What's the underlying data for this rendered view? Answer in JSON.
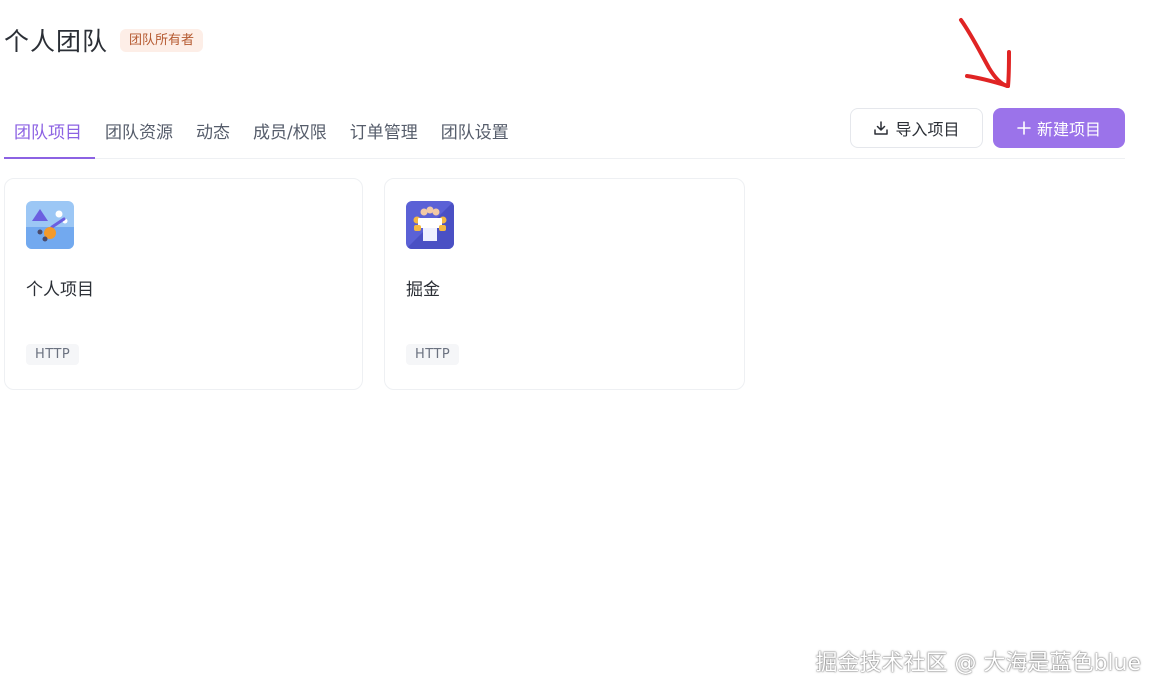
{
  "header": {
    "title": "个人团队",
    "role_badge": "团队所有者"
  },
  "tabs": [
    {
      "label": "团队项目",
      "active": true
    },
    {
      "label": "团队资源",
      "active": false
    },
    {
      "label": "动态",
      "active": false
    },
    {
      "label": "成员/权限",
      "active": false
    },
    {
      "label": "订单管理",
      "active": false
    },
    {
      "label": "团队设置",
      "active": false
    }
  ],
  "actions": {
    "import_label": "导入项目",
    "new_label": "新建项目"
  },
  "projects": [
    {
      "name": "个人项目",
      "tag": "HTTP",
      "icon": "personal-project-icon"
    },
    {
      "name": "掘金",
      "tag": "HTTP",
      "icon": "team-meeting-icon"
    }
  ],
  "watermark": "掘金技术社区 @ 大海是蓝色blue",
  "colors": {
    "accent": "#9b73ea",
    "active_tab": "#8c62e3",
    "badge_bg": "#fdeee7",
    "badge_text": "#b55a31",
    "annotation_arrow": "#e02424"
  }
}
